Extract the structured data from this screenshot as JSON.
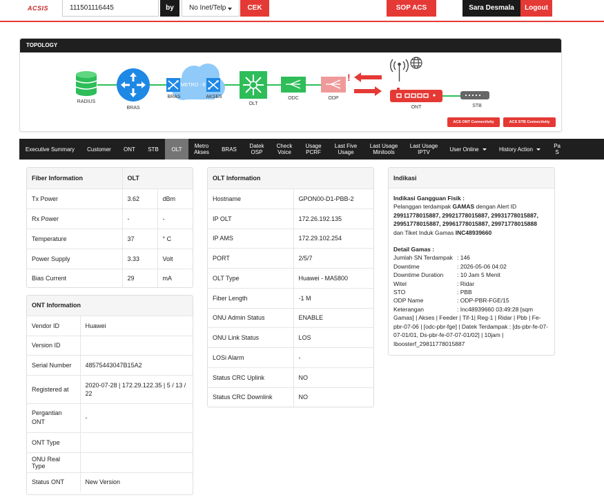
{
  "header": {
    "logo": "ACSIS",
    "search_value": "111501116445",
    "by_label": "by",
    "search_type": "No Inet/Telp",
    "cek_label": "CEK",
    "sop_label": "SOP ACS",
    "user_name": "Sara Desmala",
    "logout_label": "Logout"
  },
  "topology": {
    "title": "TOPOLOGY",
    "nodes": {
      "radius": "RADIUS",
      "bras": "BRAS",
      "metro": "METRO - E",
      "bras_port": "BRAS",
      "akses": "AKSES",
      "olt": "OLT",
      "odc": "ODC",
      "odp": "ODP",
      "alert": "!",
      "ont": "ONT",
      "stb": "STB"
    },
    "buttons": {
      "acs_ont": "ACS ONT Connectivity",
      "acs_stb": "ACS STB Connectivity"
    },
    "colors": {
      "radius": "#2ebd59",
      "bras": "#1e88e5",
      "metro": "#90caf9",
      "olt": "#2ebd59",
      "odc": "#2ebd59",
      "odp": "#ef9a9a",
      "ont": "#e53935",
      "stb": "#666666",
      "link_ok": "#2ebd59",
      "link_bad": "#e53935"
    }
  },
  "tabs": [
    {
      "label": "Executive Summary"
    },
    {
      "label": "Customer"
    },
    {
      "label": "ONT"
    },
    {
      "label": "STB"
    },
    {
      "label": "OLT",
      "active": true
    },
    {
      "label": "Metro\nAkses"
    },
    {
      "label": "BRAS"
    },
    {
      "label": "Datek\nOSP"
    },
    {
      "label": "Check\nVoice"
    },
    {
      "label": "Usage\nPCRF"
    },
    {
      "label": "Last Five\nUsage"
    },
    {
      "label": "Last Usage\nMinitools"
    },
    {
      "label": "Last Usage\nIPTV"
    },
    {
      "label": "User Online",
      "dropdown": true
    },
    {
      "label": "History Action",
      "dropdown": true
    },
    {
      "label": "Pa\nS"
    }
  ],
  "fiber": {
    "header": [
      "Fiber Information",
      "OLT"
    ],
    "rows": [
      {
        "label": "Tx Power",
        "value": "3.62",
        "unit": "dBm"
      },
      {
        "label": "Rx Power",
        "value": "-",
        "unit": "-"
      },
      {
        "label": "Temperature",
        "value": "37",
        "unit": "° C"
      },
      {
        "label": "Power Supply",
        "value": "3.33",
        "unit": "Volt"
      },
      {
        "label": "Bias Current",
        "value": "29",
        "unit": "mA"
      }
    ]
  },
  "ont": {
    "title": "ONT Information",
    "rows": [
      {
        "label": "Vendor ID",
        "value": "Huawei"
      },
      {
        "label": "Version ID",
        "value": ""
      },
      {
        "label": "Serial Number",
        "value": "48575443047B15A2"
      },
      {
        "label": "Registered at",
        "value": "2020-07-28 | 172.29.122.35 | 5 / 13 / 22"
      },
      {
        "label": "Pergantian ONT",
        "value": "-"
      },
      {
        "label": "ONT Type",
        "value": ""
      },
      {
        "label": "ONU Real Type",
        "value": ""
      },
      {
        "label": "Status ONT",
        "value": "New Version"
      }
    ]
  },
  "olt": {
    "title": "OLT Information",
    "rows": [
      {
        "label": "Hostname",
        "value": "GPON00-D1-PBB-2"
      },
      {
        "label": "IP OLT",
        "value": "172.26.192.135"
      },
      {
        "label": "IP AMS",
        "value": "172.29.102.254"
      },
      {
        "label": "PORT",
        "value": "2/5/7"
      },
      {
        "label": "OLT Type",
        "value": "Huawei - MA5800"
      },
      {
        "label": "Fiber Length",
        "value": "-1 M"
      },
      {
        "label": "ONU Admin Status",
        "value": "ENABLE"
      },
      {
        "label": "ONU Link Status",
        "value": "LOS"
      },
      {
        "label": "LOSi Alarm",
        "value": "-"
      },
      {
        "label": "Status CRC Uplink",
        "value": "NO"
      },
      {
        "label": "Status CRC Downlink",
        "value": "NO"
      }
    ]
  },
  "indikasi": {
    "title": "Indikasi",
    "heading": "Indikasi Gangguan Fisik :",
    "line1_pre": "Pelanggan terdampak ",
    "line1_bold": "GAMAS",
    "line1_post": " dengan Alert ID",
    "alert_ids": "29911778015887, 29921778015887, 29931778015887, 29951778015887, 29961778015887, 29971778015888",
    "ticket_pre": "dan Tiket Induk Gamas ",
    "ticket_id": "INC48939660",
    "detail_heading": "Detail Gamas :",
    "details": [
      {
        "k": "Jumlah SN Terdampak",
        "v": ": 146"
      },
      {
        "k": "Downtime",
        "v": ": 2026-05-06 04:02"
      },
      {
        "k": "Downtime Duration",
        "v": ": 10 Jam 5 Menit"
      },
      {
        "k": "Witel",
        "v": ": Ridar"
      },
      {
        "k": "STO",
        "v": ": PBB"
      },
      {
        "k": "ODP Name",
        "v": ": ODP-PBR-FGE/15"
      },
      {
        "k": "Keterangan",
        "v": ": Inc48939660 03:49:28 [sqm"
      }
    ],
    "keterangan_cont": "Gamas] | Akses | Feeder | Tif-1| Reg-1 | Ridar | Pbb | Fe-pbr-07-06 | [odc-pbr-fge] | Datek Terdampak : [ds-pbr-fe-07-07-01/01, Ds-pbr-fe-07-07-01/02] | 10jam | Iboosterf_29811778015887"
  }
}
